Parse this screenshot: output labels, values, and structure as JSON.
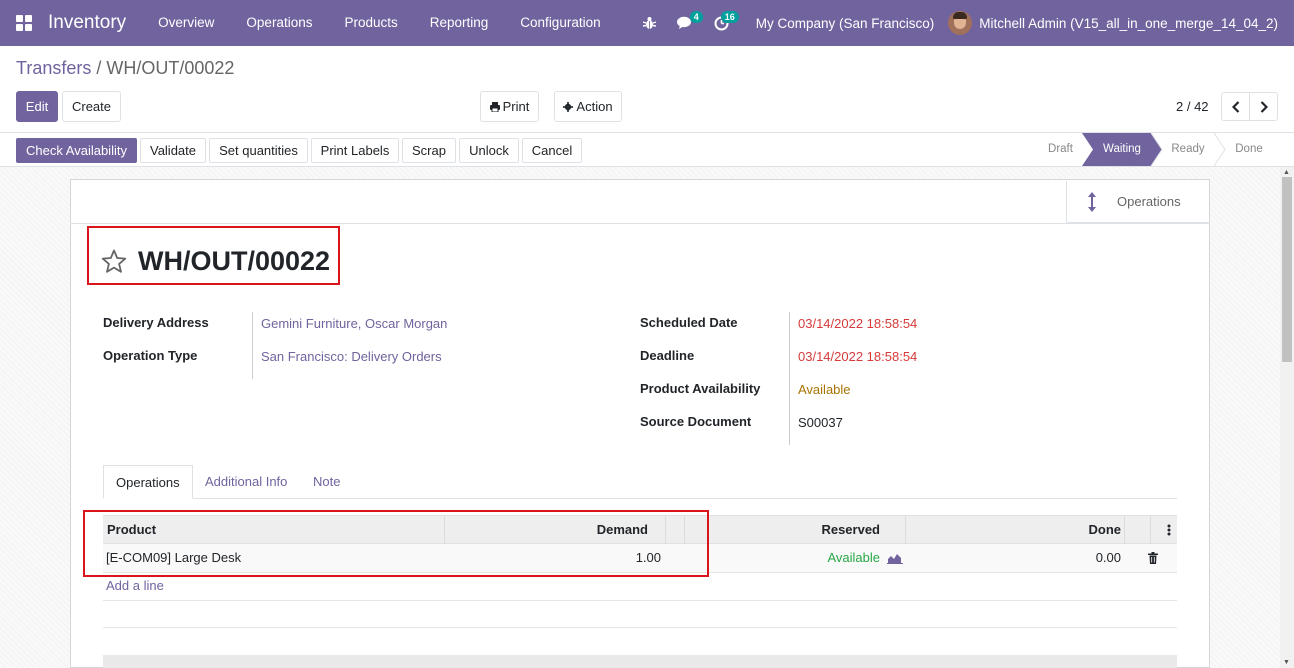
{
  "nav": {
    "brand": "Inventory",
    "menu": [
      "Overview",
      "Operations",
      "Products",
      "Reporting",
      "Configuration"
    ],
    "chat_count": "4",
    "activity_count": "16",
    "company": "My Company (San Francisco)",
    "user": "Mitchell Admin (V15_all_in_one_merge_14_04_2)"
  },
  "breadcrumb": {
    "parent": "Transfers",
    "separator": "/",
    "current": "WH/OUT/00022"
  },
  "control": {
    "edit": "Edit",
    "create": "Create",
    "print": "Print",
    "action": "Action",
    "pager": "2 / 42"
  },
  "statusbar": {
    "buttons": [
      "Check Availability",
      "Validate",
      "Set quantities",
      "Print Labels",
      "Scrap",
      "Unlock",
      "Cancel"
    ],
    "stages": [
      "Draft",
      "Waiting",
      "Ready",
      "Done"
    ],
    "active_stage": "Waiting"
  },
  "form": {
    "smart_button": "Operations",
    "title": "WH/OUT/00022",
    "left_fields": [
      {
        "label": "Delivery Address",
        "value": "Gemini Furniture, Oscar Morgan"
      },
      {
        "label": "Operation Type",
        "value": "San Francisco: Delivery Orders"
      }
    ],
    "right_fields": [
      {
        "label": "Scheduled Date",
        "value": "03/14/2022 18:58:54"
      },
      {
        "label": "Deadline",
        "value": "03/14/2022 18:58:54"
      },
      {
        "label": "Product Availability",
        "value": "Available"
      },
      {
        "label": "Source Document",
        "value": "S00037"
      }
    ],
    "tabs": [
      "Operations",
      "Additional Info",
      "Note"
    ],
    "table": {
      "headers": {
        "product": "Product",
        "demand": "Demand",
        "reserved": "Reserved",
        "done": "Done"
      },
      "rows": [
        {
          "product": "[E-COM09] Large Desk",
          "demand": "1.00",
          "reserved": "Available",
          "done": "0.00"
        }
      ],
      "add_line": "Add a line"
    }
  },
  "colors": {
    "brand": "#71639e",
    "danger": "#d63a3a",
    "success": "#28a745",
    "highlight": "#d9141a"
  }
}
